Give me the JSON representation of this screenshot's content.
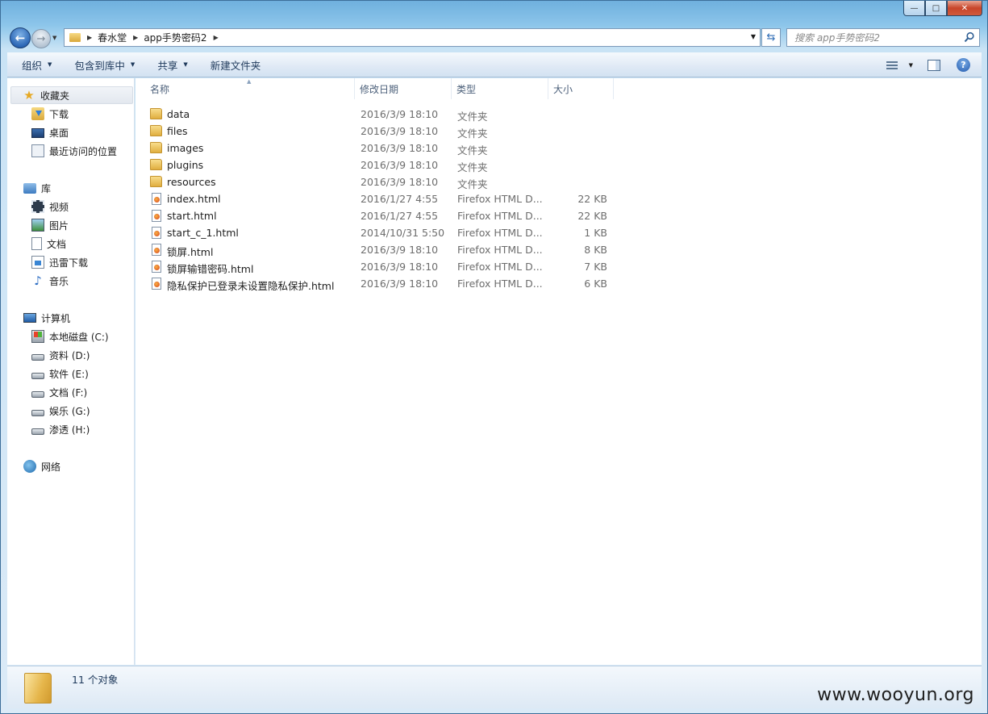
{
  "window": {
    "minimize_glyph": "—",
    "maximize_glyph": "□",
    "close_glyph": "✕"
  },
  "address_bar": {
    "crumbs": [
      "春水堂",
      "app手势密码2"
    ]
  },
  "search": {
    "placeholder": "搜索 app手势密码2"
  },
  "toolbar": {
    "organize": "组织",
    "include_library": "包含到库中",
    "share": "共享",
    "new_folder": "新建文件夹"
  },
  "sidebar": {
    "favorites": {
      "label": "收藏夹",
      "items": [
        "下载",
        "桌面",
        "最近访问的位置"
      ]
    },
    "libraries": {
      "label": "库",
      "items": [
        "视频",
        "图片",
        "文档",
        "迅雷下载",
        "音乐"
      ]
    },
    "computer": {
      "label": "计算机",
      "items": [
        "本地磁盘 (C:)",
        "资料 (D:)",
        "软件 (E:)",
        "文档 (F:)",
        "娱乐 (G:)",
        "渗透 (H:)"
      ]
    },
    "network": {
      "label": "网络"
    }
  },
  "columns": {
    "name": "名称",
    "date": "修改日期",
    "type": "类型",
    "size": "大小"
  },
  "files": [
    {
      "name": "data",
      "date": "2016/3/9 18:10",
      "type": "文件夹",
      "size": "",
      "kind": "folder"
    },
    {
      "name": "files",
      "date": "2016/3/9 18:10",
      "type": "文件夹",
      "size": "",
      "kind": "folder"
    },
    {
      "name": "images",
      "date": "2016/3/9 18:10",
      "type": "文件夹",
      "size": "",
      "kind": "folder"
    },
    {
      "name": "plugins",
      "date": "2016/3/9 18:10",
      "type": "文件夹",
      "size": "",
      "kind": "folder"
    },
    {
      "name": "resources",
      "date": "2016/3/9 18:10",
      "type": "文件夹",
      "size": "",
      "kind": "folder"
    },
    {
      "name": "index.html",
      "date": "2016/1/27 4:55",
      "type": "Firefox HTML D...",
      "size": "22 KB",
      "kind": "html"
    },
    {
      "name": "start.html",
      "date": "2016/1/27 4:55",
      "type": "Firefox HTML D...",
      "size": "22 KB",
      "kind": "html"
    },
    {
      "name": "start_c_1.html",
      "date": "2014/10/31 5:50",
      "type": "Firefox HTML D...",
      "size": "1 KB",
      "kind": "html"
    },
    {
      "name": "锁屏.html",
      "date": "2016/3/9 18:10",
      "type": "Firefox HTML D...",
      "size": "8 KB",
      "kind": "html"
    },
    {
      "name": "锁屏输错密码.html",
      "date": "2016/3/9 18:10",
      "type": "Firefox HTML D...",
      "size": "7 KB",
      "kind": "html"
    },
    {
      "name": "隐私保护已登录未设置隐私保护.html",
      "date": "2016/3/9 18:10",
      "type": "Firefox HTML D...",
      "size": "6 KB",
      "kind": "html"
    }
  ],
  "details": {
    "count": "11 个对象"
  },
  "watermark": "www.wooyun.org"
}
